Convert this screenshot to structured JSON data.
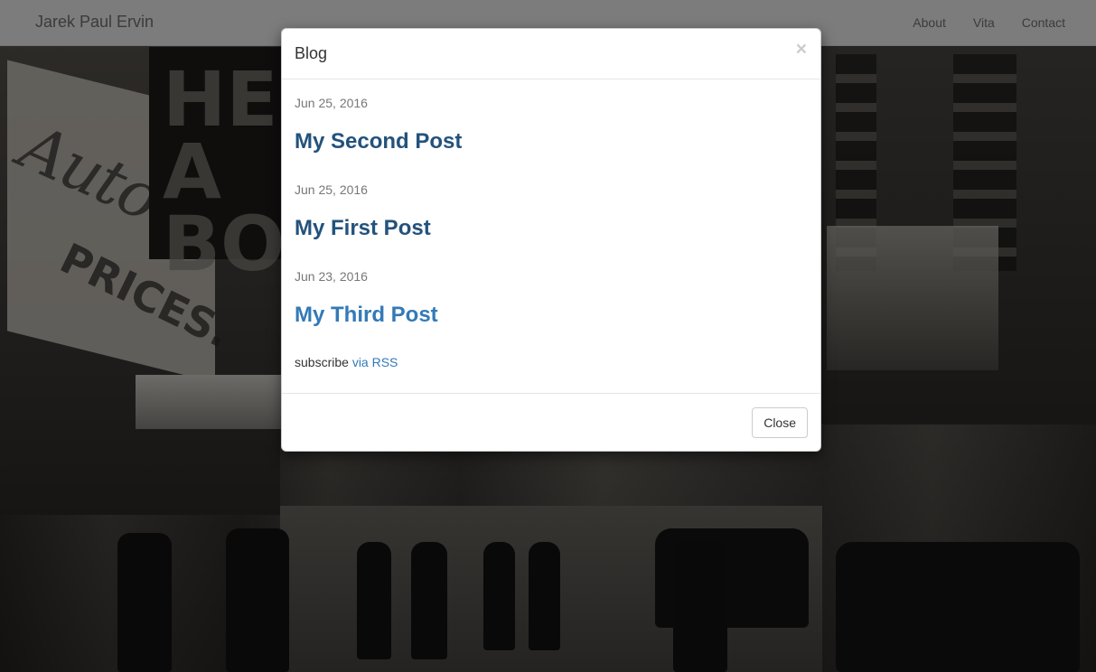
{
  "navbar": {
    "brand": "Jarek Paul Ervin",
    "links": [
      "About",
      "Vita",
      "Contact"
    ]
  },
  "modal": {
    "title": "Blog",
    "close_symbol": "×",
    "posts": [
      {
        "date": "Jun 25, 2016",
        "title": "My Second Post"
      },
      {
        "date": "Jun 25, 2016",
        "title": "My First Post"
      },
      {
        "date": "Jun 23, 2016",
        "title": "My Third Post"
      }
    ],
    "subscribe_text": "subscribe",
    "subscribe_link": "via RSS",
    "close_button": "Close"
  },
  "background": {
    "sign_auto": "Auto",
    "sign_prices": "PRICES.",
    "sign_hb": "HE A BO"
  },
  "colors": {
    "link_visited": "#23527c",
    "link": "#337ab7",
    "muted": "#777777"
  }
}
